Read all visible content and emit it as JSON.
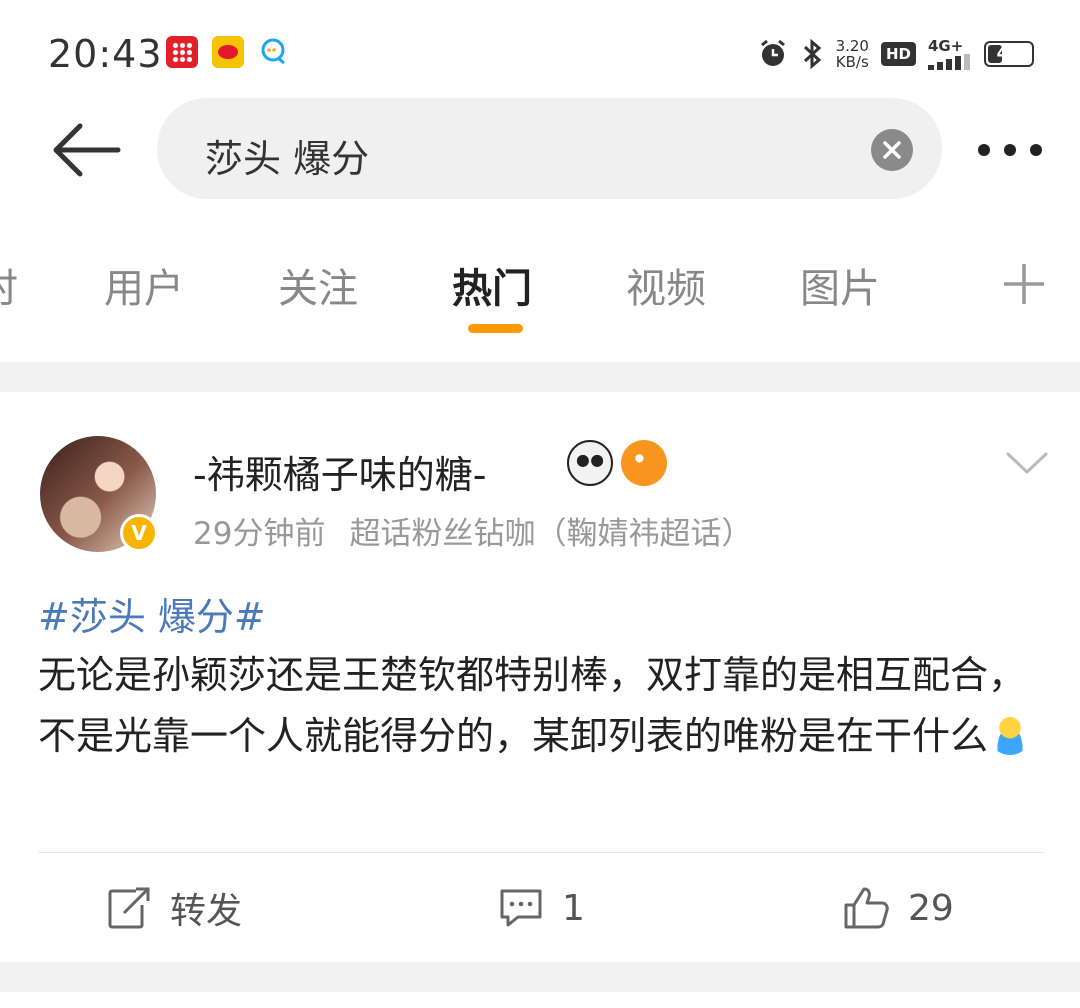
{
  "status_bar": {
    "time": "20:43",
    "net_speed_value": "3.20",
    "net_speed_unit": "KB/s",
    "hd_label": "HD",
    "signal_label": "4G+",
    "battery_level": "40",
    "icons": [
      "pinduoduo-icon",
      "weibo-icon",
      "chat-bubble-icon",
      "alarm-icon",
      "bluetooth-icon"
    ]
  },
  "search": {
    "query": "莎头 爆分"
  },
  "tabs": [
    {
      "label": "时"
    },
    {
      "label": "用户"
    },
    {
      "label": "关注"
    },
    {
      "label": "热门",
      "active": true
    },
    {
      "label": "视频"
    },
    {
      "label": "图片"
    }
  ],
  "post": {
    "username": "-祎颗橘子味的糖-",
    "time": "29分钟前",
    "source": "超话粉丝钻咖（鞠婧祎超话）",
    "hashtag": "#莎头 爆分#",
    "text": "无论是孙颖莎还是王楚钦都特别棒，双打靠的是相互配合，不是光靠一个人就能得分的，某卸列表的唯粉是在干什么",
    "actions": {
      "repost_label": "转发",
      "comment_count": "1",
      "like_count": "29"
    }
  },
  "colors": {
    "accent_orange": "#ff9a00",
    "hashtag_blue": "#4a7ab8",
    "verified_gold": "#f7b500"
  }
}
